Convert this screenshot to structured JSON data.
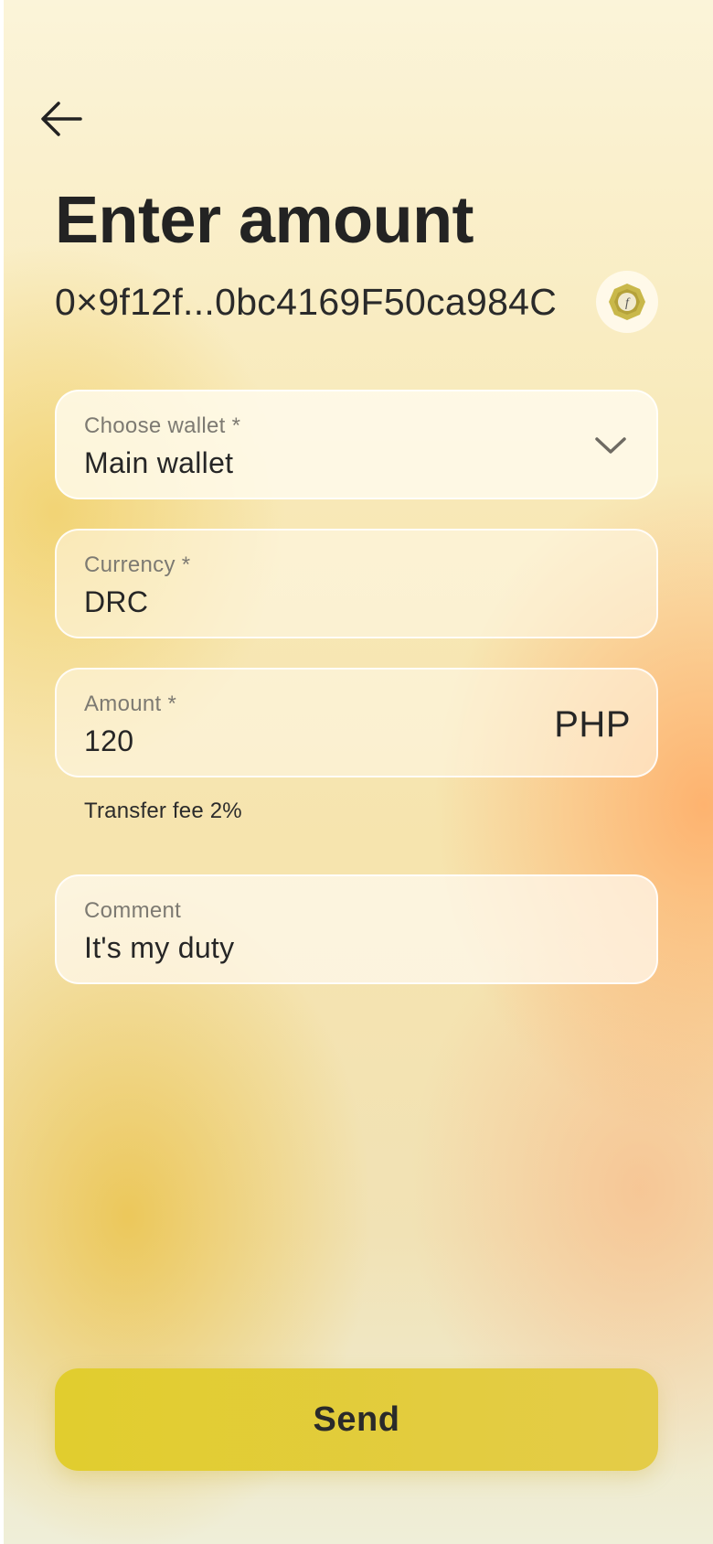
{
  "header": {
    "title": "Enter amount",
    "recipient_address": "0×9f12f...0bc4169F50ca984C"
  },
  "icons": {
    "back": "arrow-left-icon",
    "coin": "coin-icon",
    "dropdown": "chevron-down-icon"
  },
  "form": {
    "wallet": {
      "label": "Choose wallet *",
      "value": "Main wallet"
    },
    "currency": {
      "label": "Currency *",
      "value": "DRC"
    },
    "amount": {
      "label": "Amount *",
      "value": "120",
      "unit": "PHP"
    },
    "transfer_fee": "Transfer fee 2%",
    "comment": {
      "label": "Comment",
      "value": "It's my duty"
    }
  },
  "actions": {
    "send_label": "Send"
  },
  "colors": {
    "send_button": "#e1cd2e",
    "text": "#222222",
    "label": "#7d7a72",
    "coin": "#c9b84a"
  }
}
